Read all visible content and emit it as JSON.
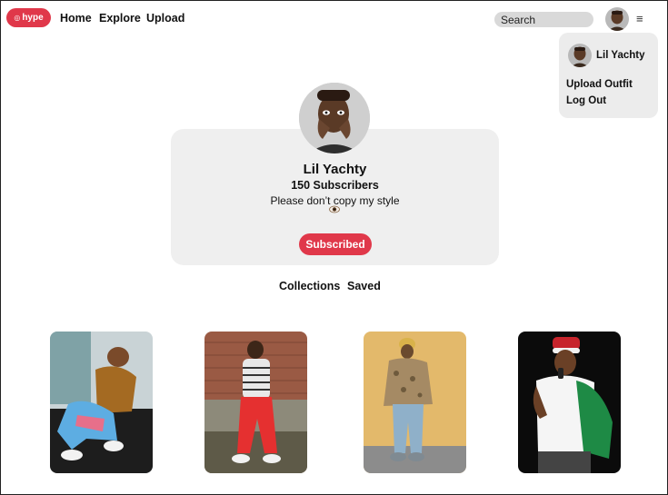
{
  "header": {
    "logo_text": "hype",
    "nav": [
      {
        "label": "Home"
      },
      {
        "label": "Explore"
      },
      {
        "label": "Upload"
      }
    ],
    "search_placeholder": "Search"
  },
  "dropdown": {
    "username": "Lil Yachty",
    "items": [
      {
        "label": "Upload Outfit"
      },
      {
        "label": "Log Out"
      }
    ]
  },
  "profile": {
    "name": "Lil Yachty",
    "subscribers": "150 Subscribers",
    "bio": "Please don’t copy my style",
    "button_label": "Subscribed"
  },
  "tabs": [
    {
      "label": "Collections"
    },
    {
      "label": "Saved"
    }
  ],
  "gallery": {
    "count": 4
  },
  "colors": {
    "accent": "#e0384a",
    "card_bg": "#efefef",
    "search_bg": "#d9d9d9"
  }
}
